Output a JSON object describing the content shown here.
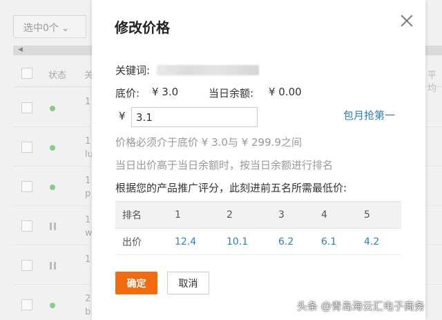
{
  "background": {
    "select_label": "选中0个",
    "header": {
      "status": "状态",
      "col3": "关",
      "right": "平均"
    },
    "rows": [
      {
        "state": "active",
        "text": "1"
      },
      {
        "state": "active",
        "text": "1\nlu"
      },
      {
        "state": "active",
        "text": "1\np"
      },
      {
        "state": "paused",
        "text": "1\nw"
      },
      {
        "state": "paused",
        "text": "1"
      },
      {
        "state": "active",
        "text": "2\nb"
      }
    ]
  },
  "modal": {
    "title": "修改价格",
    "keyword_label": "关键词:",
    "base_price_label": "底价:",
    "base_price_value": "¥ 3.0",
    "daily_balance_label": "当日余额:",
    "daily_balance_value": "¥ 0.00",
    "currency_symbol": "¥",
    "price_input_value": "3.1",
    "monthly_link": "包月抢第一",
    "hint_range": "价格必须介于底价 ¥ 3.0与 ¥ 299.9之间",
    "hint_balance": "当日出价高于当日余额时，按当日余额进行排名",
    "rank_intro": "根据您的产品推广评分，此刻进前五名所需最低价:",
    "rank_table": {
      "rank_header": "排名",
      "price_header": "出价",
      "ranks": [
        "1",
        "2",
        "3",
        "4",
        "5"
      ],
      "prices": [
        "12.4",
        "10.1",
        "6.2",
        "6.1",
        "4.2"
      ]
    },
    "confirm_label": "确定",
    "cancel_label": "取消"
  },
  "watermark": "头条 @青岛海云汇电子商务",
  "colors": {
    "accent": "#f26b11",
    "link": "#2e7fb8",
    "status_active": "#8cc98c"
  },
  "icons": {
    "close": "close-icon",
    "select_chevron": "chevron-down-icon",
    "scroll_left": "arrow-left-icon"
  }
}
